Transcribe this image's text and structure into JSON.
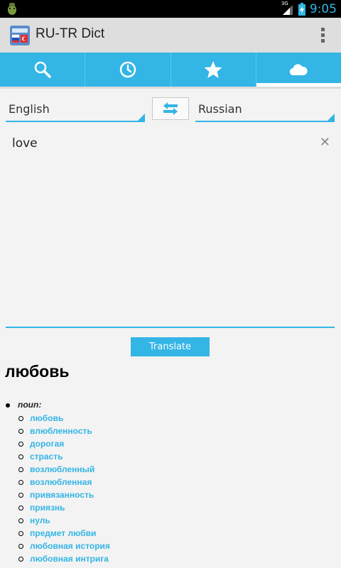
{
  "status_bar": {
    "time": "9:05",
    "network": "3G"
  },
  "app": {
    "title": "RU-TR Dict"
  },
  "tabs": [
    {
      "icon": "search-icon",
      "selected": false
    },
    {
      "icon": "history-clock-icon",
      "selected": false
    },
    {
      "icon": "star-icon",
      "selected": false
    },
    {
      "icon": "cloud-icon",
      "selected": true
    }
  ],
  "language": {
    "source": "English",
    "target": "Russian"
  },
  "input": {
    "value": "love"
  },
  "translate_button": "Translate",
  "result": {
    "word": "любовь",
    "part_of_speech": "noun:",
    "translations": [
      "любовь",
      "влюбленность",
      "дорогая",
      "страсть",
      "возлюбленный",
      "возлюбленная",
      "привязанность",
      "приязнь",
      "нуль",
      "предмет любви",
      "любовная история",
      "любовная интрига"
    ]
  },
  "colors": {
    "accent": "#33b5e5",
    "actionbar": "#dedede",
    "background": "#f3f3f3"
  }
}
